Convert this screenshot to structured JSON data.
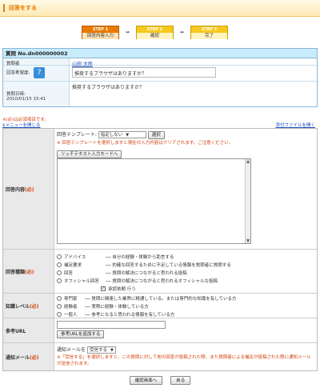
{
  "page": {
    "title": "回答をする"
  },
  "steps": [
    {
      "num": "STEP 1",
      "label": "回答内容入力",
      "active": true
    },
    {
      "num": "STEP 2",
      "label": "確認",
      "active": false
    },
    {
      "num": "STEP 3",
      "label": "完了",
      "active": false
    }
  ],
  "question": {
    "heading": "質問  No.dn000000002",
    "asker_label": "質問者",
    "asker_value": "山田 太郎",
    "hope_label": "回答希望度:",
    "hope_text": "推奨するブラウザはありますか？",
    "date_label": "質問日時:",
    "date_value": "2010/01/15 15:41",
    "body": "推奨するブラウザはありますか？"
  },
  "notice": "※(必)は必須項目です。",
  "menu_link": "$メニューを開じる",
  "attach_link": "添付ファイルを開く",
  "form": {
    "answer": {
      "label": "回答内容",
      "req": "(必)",
      "template_label": "回答テンプレート:",
      "template_value": "指定しない",
      "select_button": "選択",
      "template_warning": "※ 回答テンプレートを選択しますと現在の入力内容はクリアされます。ご注意ください。",
      "richtext_button": "リッチテキスト入力モードへ"
    },
    "type": {
      "label": "回答種類",
      "req": "(必)",
      "options": [
        {
          "name": "アドバイス",
          "desc": "── 自分の経験・体験から助言する"
        },
        {
          "name": "補足要求",
          "desc": "── 的確な回答するために不足している情報を質問者に質問する"
        },
        {
          "name": "回答",
          "desc": "── 質問の解決につながると思われる投稿"
        },
        {
          "name": "オフィシャル回答",
          "desc": "── 質問の解決につながると思われるオフィシャルな投稿"
        }
      ],
      "approval_label": "承認依頼 行う"
    },
    "level": {
      "label": "知識レベル",
      "req": "(必)",
      "options": [
        {
          "name": "専門家",
          "desc": "── 質問に関連した業界に精通している。または専門的な知識を有している方"
        },
        {
          "name": "経験者",
          "desc": "── 実際に経験・体験している方"
        },
        {
          "name": "一般人",
          "desc": "── 参考になると思われる情報を有している方"
        }
      ]
    },
    "url": {
      "label": "参考URL",
      "add_button": "参考URLを追加する"
    },
    "notify": {
      "label": "通知メール",
      "req": "(必)",
      "field_label": "通知メールを",
      "field_value": "受信する",
      "note": "※「受信する」を選択しますと、この質問に対して他の回答が投稿された際、また質問者による補足が投稿された際に通知メールが送信されます。"
    }
  },
  "footer": {
    "confirm_button": "確認画面へ",
    "back_button": "戻る"
  }
}
